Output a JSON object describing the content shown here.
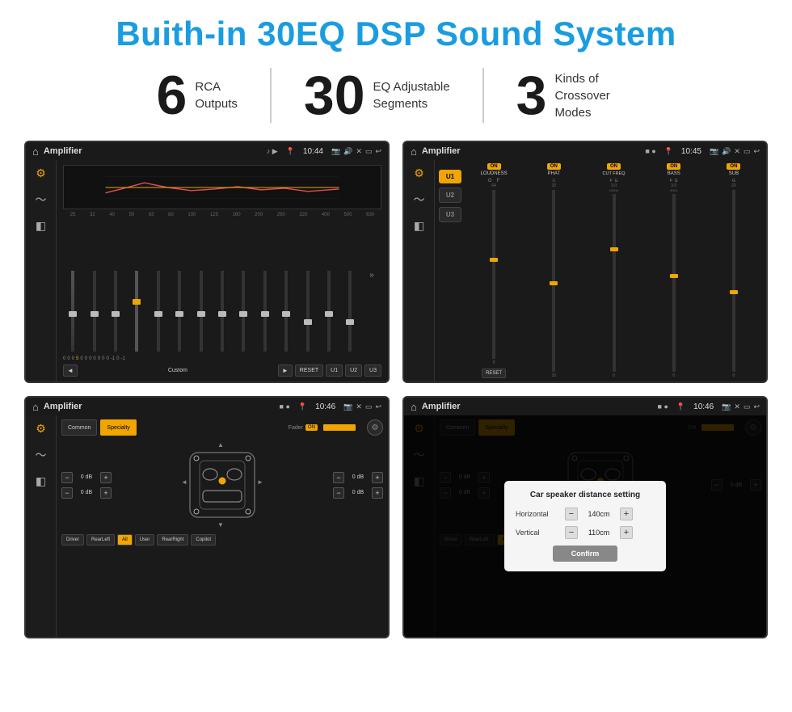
{
  "page": {
    "title": "Buith-in 30EQ DSP Sound System",
    "stats": [
      {
        "number": "6",
        "text": "RCA\nOutputs"
      },
      {
        "number": "30",
        "text": "EQ Adjustable\nSegments"
      },
      {
        "number": "3",
        "text": "Kinds of\nCrossover Modes"
      }
    ]
  },
  "screen1": {
    "app": "Amplifier",
    "time": "10:44",
    "freq_labels": [
      "25",
      "32",
      "40",
      "50",
      "63",
      "80",
      "100",
      "125",
      "160",
      "200",
      "250",
      "320",
      "400",
      "500",
      "630"
    ],
    "slider_values": [
      "0",
      "0",
      "0",
      "5",
      "0",
      "0",
      "0",
      "0",
      "0",
      "0",
      "0",
      "-1",
      "0",
      "-1"
    ],
    "buttons": [
      "◄",
      "Custom",
      "►",
      "RESET",
      "U1",
      "U2",
      "U3"
    ]
  },
  "screen2": {
    "app": "Amplifier",
    "time": "10:45",
    "presets": [
      "U1",
      "U2",
      "U3"
    ],
    "channels": [
      {
        "on": true,
        "name": "LOUDNESS"
      },
      {
        "on": true,
        "name": "PHAT"
      },
      {
        "on": true,
        "name": "CUT FREQ"
      },
      {
        "on": true,
        "name": "BASS"
      },
      {
        "on": true,
        "name": "SUB"
      }
    ],
    "reset_label": "RESET"
  },
  "screen3": {
    "app": "Amplifier",
    "time": "10:46",
    "tabs": [
      "Common",
      "Specialty"
    ],
    "fader_label": "Fader",
    "fader_on": "ON",
    "levels": [
      {
        "value": "0 dB"
      },
      {
        "value": "0 dB"
      },
      {
        "value": "0 dB"
      },
      {
        "value": "0 dB"
      }
    ],
    "labels": [
      "Driver",
      "RearLeft",
      "All",
      "User",
      "RearRight",
      "Copilot"
    ]
  },
  "screen4": {
    "app": "Amplifier",
    "time": "10:46",
    "tabs": [
      "Common",
      "Specialty"
    ],
    "dialog": {
      "title": "Car speaker distance setting",
      "horizontal_label": "Horizontal",
      "horizontal_value": "140cm",
      "vertical_label": "Vertical",
      "vertical_value": "110cm",
      "confirm_label": "Confirm"
    },
    "levels": [
      {
        "value": "0 dB"
      },
      {
        "value": "0 dB"
      }
    ],
    "labels": [
      "Driver",
      "RearLeft.",
      "All",
      "User",
      "RearRight",
      "Copilot"
    ]
  }
}
